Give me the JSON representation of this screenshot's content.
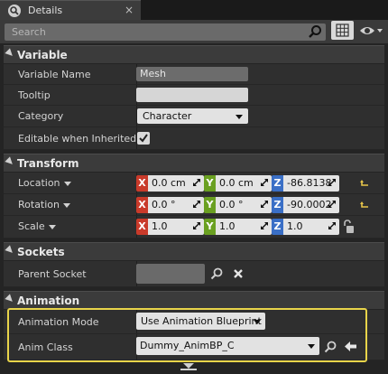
{
  "tab": {
    "title": "Details",
    "close": "×"
  },
  "search": {
    "placeholder": "Search"
  },
  "sections": {
    "variable": {
      "title": "Variable",
      "variable_name_label": "Variable Name",
      "variable_name_value": "Mesh",
      "tooltip_label": "Tooltip",
      "category_label": "Category",
      "category_value": "Character",
      "editable_label": "Editable when Inherited",
      "editable_checked": true
    },
    "transform": {
      "title": "Transform",
      "location_label": "Location",
      "location": {
        "x": "0.0 cm",
        "y": "0.0 cm",
        "z": "-86.8138"
      },
      "rotation_label": "Rotation",
      "rotation": {
        "x": "0.0 °",
        "y": "0.0 °",
        "z": "-90.0002"
      },
      "scale_label": "Scale",
      "scale": {
        "x": "1.0",
        "y": "1.0",
        "z": "1.0"
      },
      "axis_x": "X",
      "axis_y": "Y",
      "axis_z": "Z"
    },
    "sockets": {
      "title": "Sockets",
      "parent_socket_label": "Parent Socket"
    },
    "animation": {
      "title": "Animation",
      "mode_label": "Animation Mode",
      "mode_value": "Use Animation Blueprint",
      "class_label": "Anim Class",
      "class_value": "Dummy_AnimBP_C"
    }
  },
  "colors": {
    "highlight": "#e8d44a",
    "axis_x": "#c93a2a",
    "axis_y": "#6aa021",
    "axis_z": "#3a6fc6"
  }
}
